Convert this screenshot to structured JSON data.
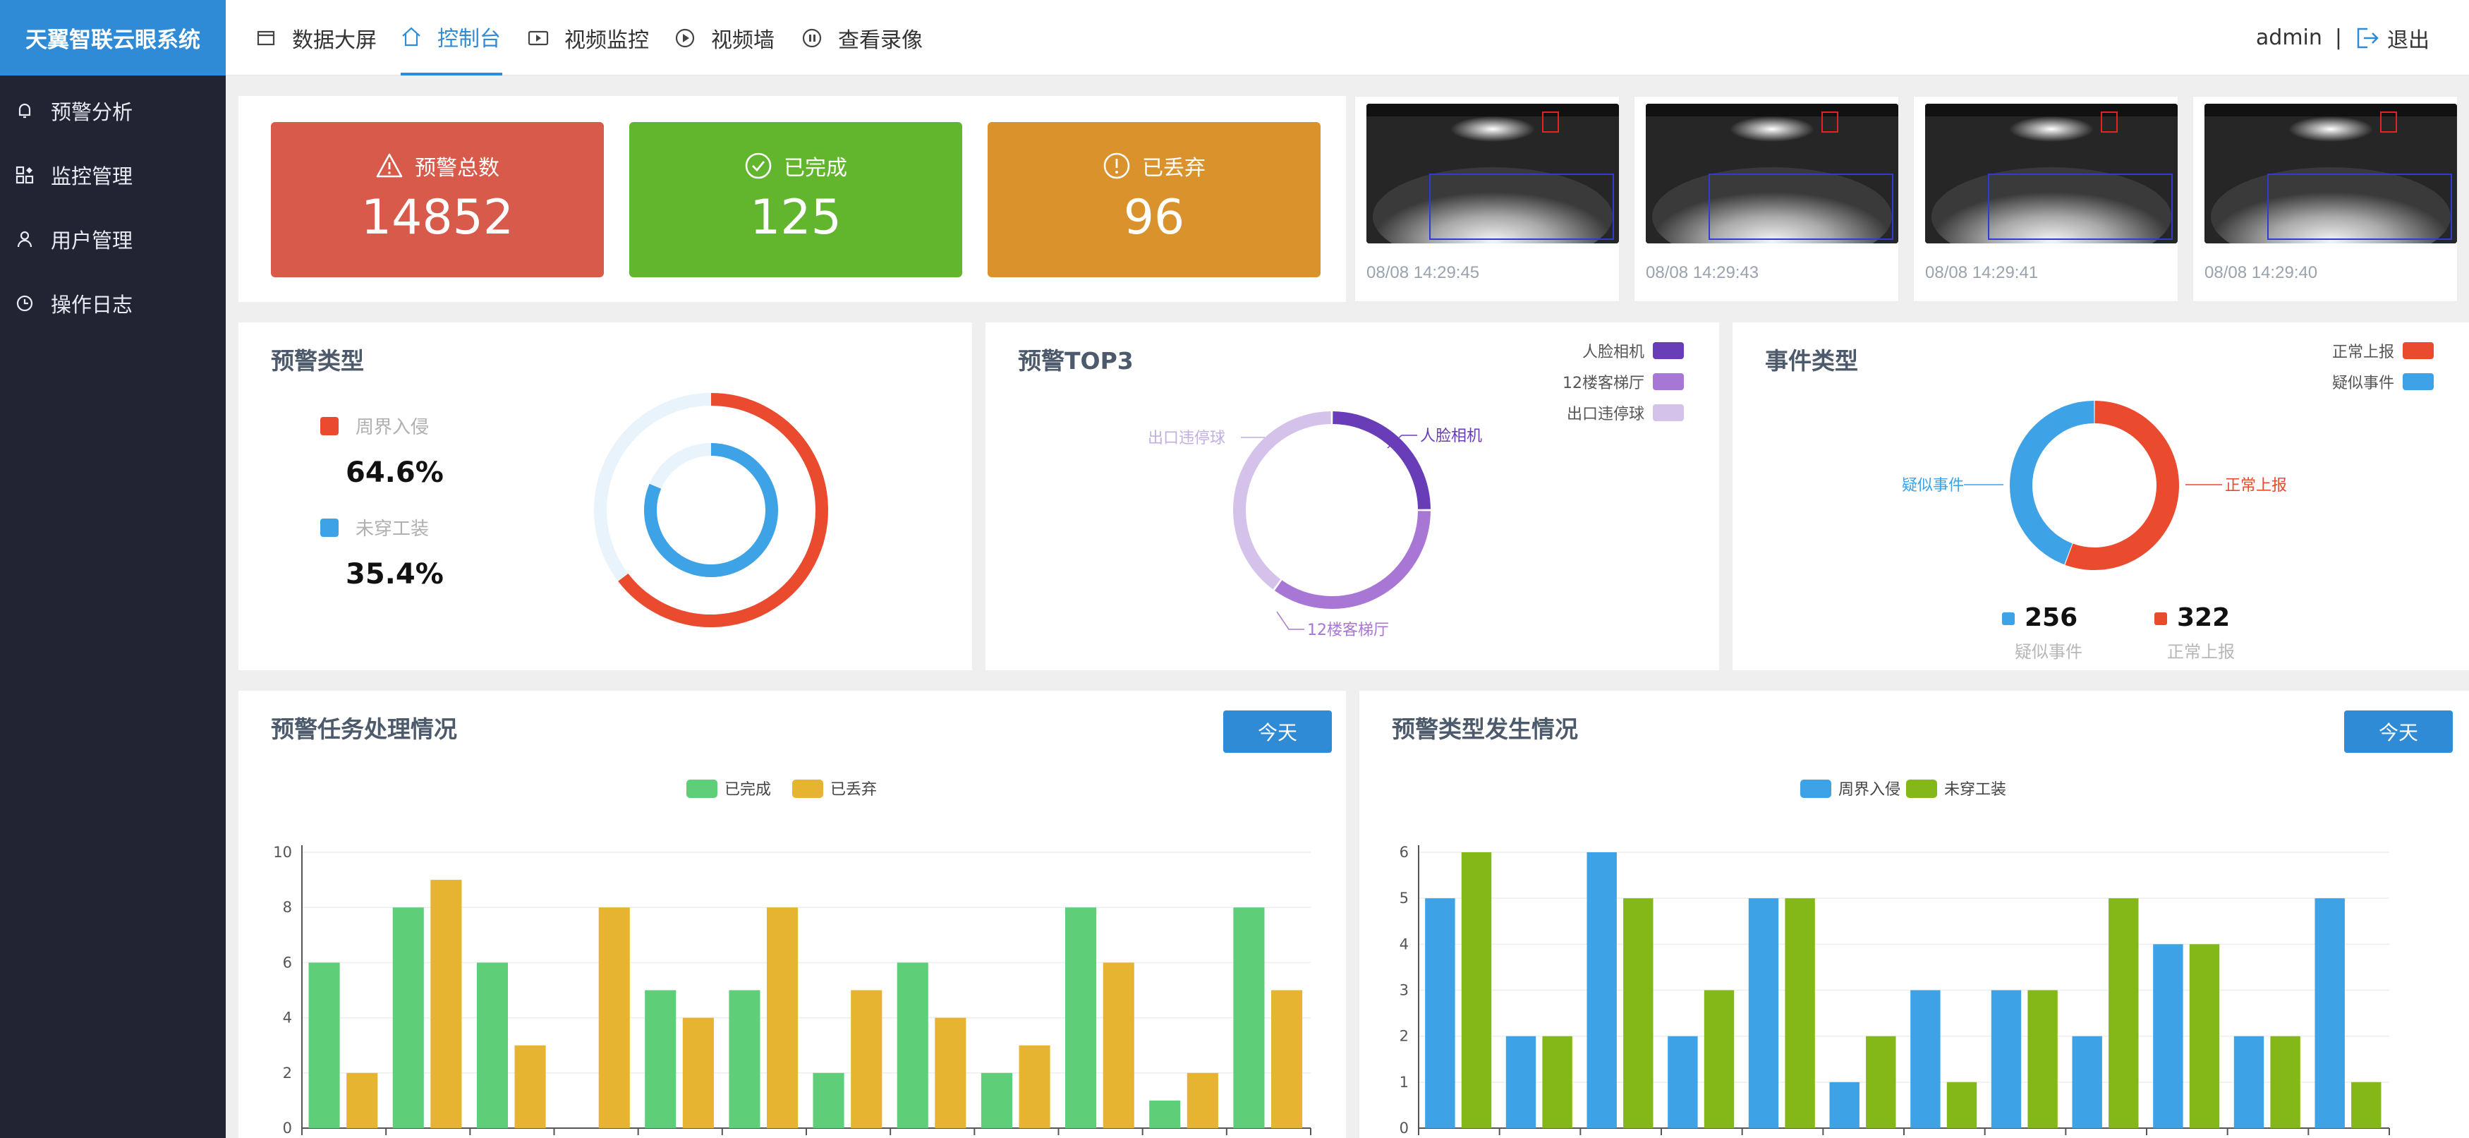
{
  "app": {
    "title": "天翼智联云眼系统"
  },
  "sidebar": {
    "items": [
      {
        "label": "预警分析",
        "icon": "bell-icon"
      },
      {
        "label": "监控管理",
        "icon": "grid-icon"
      },
      {
        "label": "用户管理",
        "icon": "user-icon"
      },
      {
        "label": "操作日志",
        "icon": "clock-icon"
      }
    ]
  },
  "header": {
    "nav": [
      {
        "label": "数据大屏",
        "icon": "monitor-icon"
      },
      {
        "label": "控制台",
        "icon": "home-icon",
        "active": true
      },
      {
        "label": "视频监控",
        "icon": "video-icon"
      },
      {
        "label": "视频墙",
        "icon": "play-icon"
      },
      {
        "label": "查看录像",
        "icon": "pause-icon"
      }
    ],
    "user": "admin",
    "separator": "|",
    "logout": "退出"
  },
  "stats": [
    {
      "label": "预警总数",
      "value": "14852",
      "color": "#d75a4a",
      "icon": "warning-icon"
    },
    {
      "label": "已完成",
      "value": "125",
      "color": "#62b62e",
      "icon": "check-circle-icon"
    },
    {
      "label": "已丢弃",
      "value": "96",
      "color": "#da922d",
      "icon": "exclamation-circle-icon"
    }
  ],
  "thumbnails": [
    {
      "timestamp": "08/08 14:29:45"
    },
    {
      "timestamp": "08/08 14:29:43"
    },
    {
      "timestamp": "08/08 14:29:41"
    },
    {
      "timestamp": "08/08 14:29:40"
    }
  ],
  "alarm_type": {
    "title": "预警类型",
    "items": [
      {
        "label": "周界入侵",
        "value": "64.6%",
        "color": "#ea4a2d"
      },
      {
        "label": "未穿工装",
        "value": "35.4%",
        "color": "#3ea2e6"
      }
    ]
  },
  "top3": {
    "title": "预警TOP3",
    "items": [
      {
        "label": "人脸相机",
        "color": "#6a3db8"
      },
      {
        "label": "12楼客梯厅",
        "color": "#a876d4"
      },
      {
        "label": "出口违停球",
        "color": "#d5c2ea"
      }
    ]
  },
  "event_type": {
    "title": "事件类型",
    "items": [
      {
        "label": "正常上报",
        "value": "322",
        "color": "#ea4a2d"
      },
      {
        "label": "疑似事件",
        "value": "256",
        "color": "#3ea2e6"
      }
    ]
  },
  "task_chart": {
    "title": "预警任务处理情况",
    "button": "今天"
  },
  "type_chart": {
    "title": "预警类型发生情况",
    "button": "今天"
  },
  "chart_data": [
    {
      "type": "pie",
      "title": "预警类型",
      "series": [
        {
          "name": "周界入侵",
          "value": 64.6
        },
        {
          "name": "未穿工装",
          "value": 35.4
        }
      ]
    },
    {
      "type": "pie",
      "title": "预警TOP3",
      "series": [
        {
          "name": "人脸相机",
          "value": 25
        },
        {
          "name": "12楼客梯厅",
          "value": 35
        },
        {
          "name": "出口违停球",
          "value": 40
        }
      ]
    },
    {
      "type": "pie",
      "title": "事件类型",
      "series": [
        {
          "name": "疑似事件",
          "value": 256
        },
        {
          "name": "正常上报",
          "value": 322
        }
      ]
    },
    {
      "type": "bar",
      "title": "预警任务处理情况",
      "ylim": [
        0,
        10
      ],
      "yticks": [
        0,
        2,
        4,
        6,
        8,
        10
      ],
      "series": [
        {
          "name": "已完成",
          "color": "#5fce78",
          "values": [
            6,
            8,
            6,
            0,
            5,
            5,
            2,
            6,
            2,
            8,
            1,
            8
          ]
        },
        {
          "name": "已丢弃",
          "color": "#e7b431",
          "values": [
            2,
            9,
            3,
            8,
            4,
            8,
            5,
            4,
            3,
            6,
            2,
            5
          ]
        }
      ]
    },
    {
      "type": "bar",
      "title": "预警类型发生情况",
      "ylim": [
        0,
        6
      ],
      "yticks": [
        0,
        1,
        2,
        3,
        4,
        5,
        6
      ],
      "series": [
        {
          "name": "周界入侵",
          "color": "#3ea2e6",
          "values": [
            5,
            2,
            6,
            2,
            5,
            1,
            3,
            3,
            2,
            4,
            2,
            5
          ]
        },
        {
          "name": "未穿工装",
          "color": "#84b818",
          "values": [
            6,
            2,
            5,
            3,
            5,
            2,
            1,
            3,
            5,
            4,
            2,
            1
          ]
        }
      ]
    }
  ]
}
